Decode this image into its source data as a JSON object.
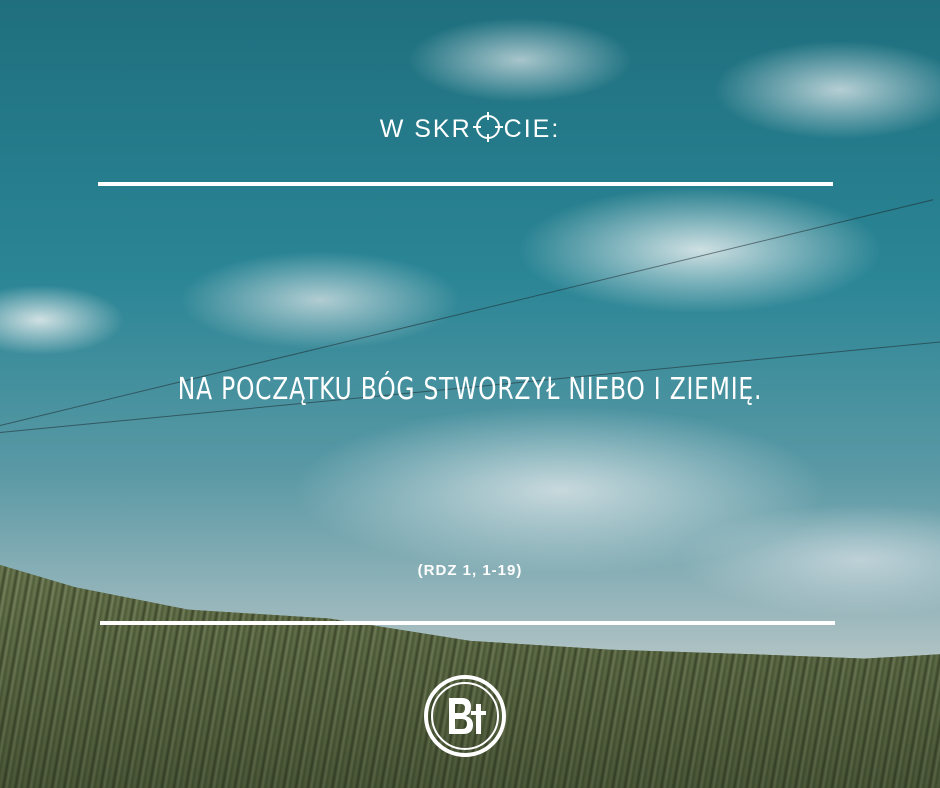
{
  "heading": {
    "before": "W SKR",
    "after": "CIE:",
    "target_icon": "crosshair-target-icon"
  },
  "quote": "NA POCZĄTKU BÓG STWORZYŁ NIEBO I ZIEMIĘ.",
  "reference": "(RDZ 1, 1-19)",
  "logo": {
    "icon": "bt-cross-logo",
    "letters": "Bt"
  },
  "colors": {
    "text": "#ffffff",
    "rules": "#ffffff",
    "sky": "#2a8595",
    "grass": "#55633e"
  }
}
